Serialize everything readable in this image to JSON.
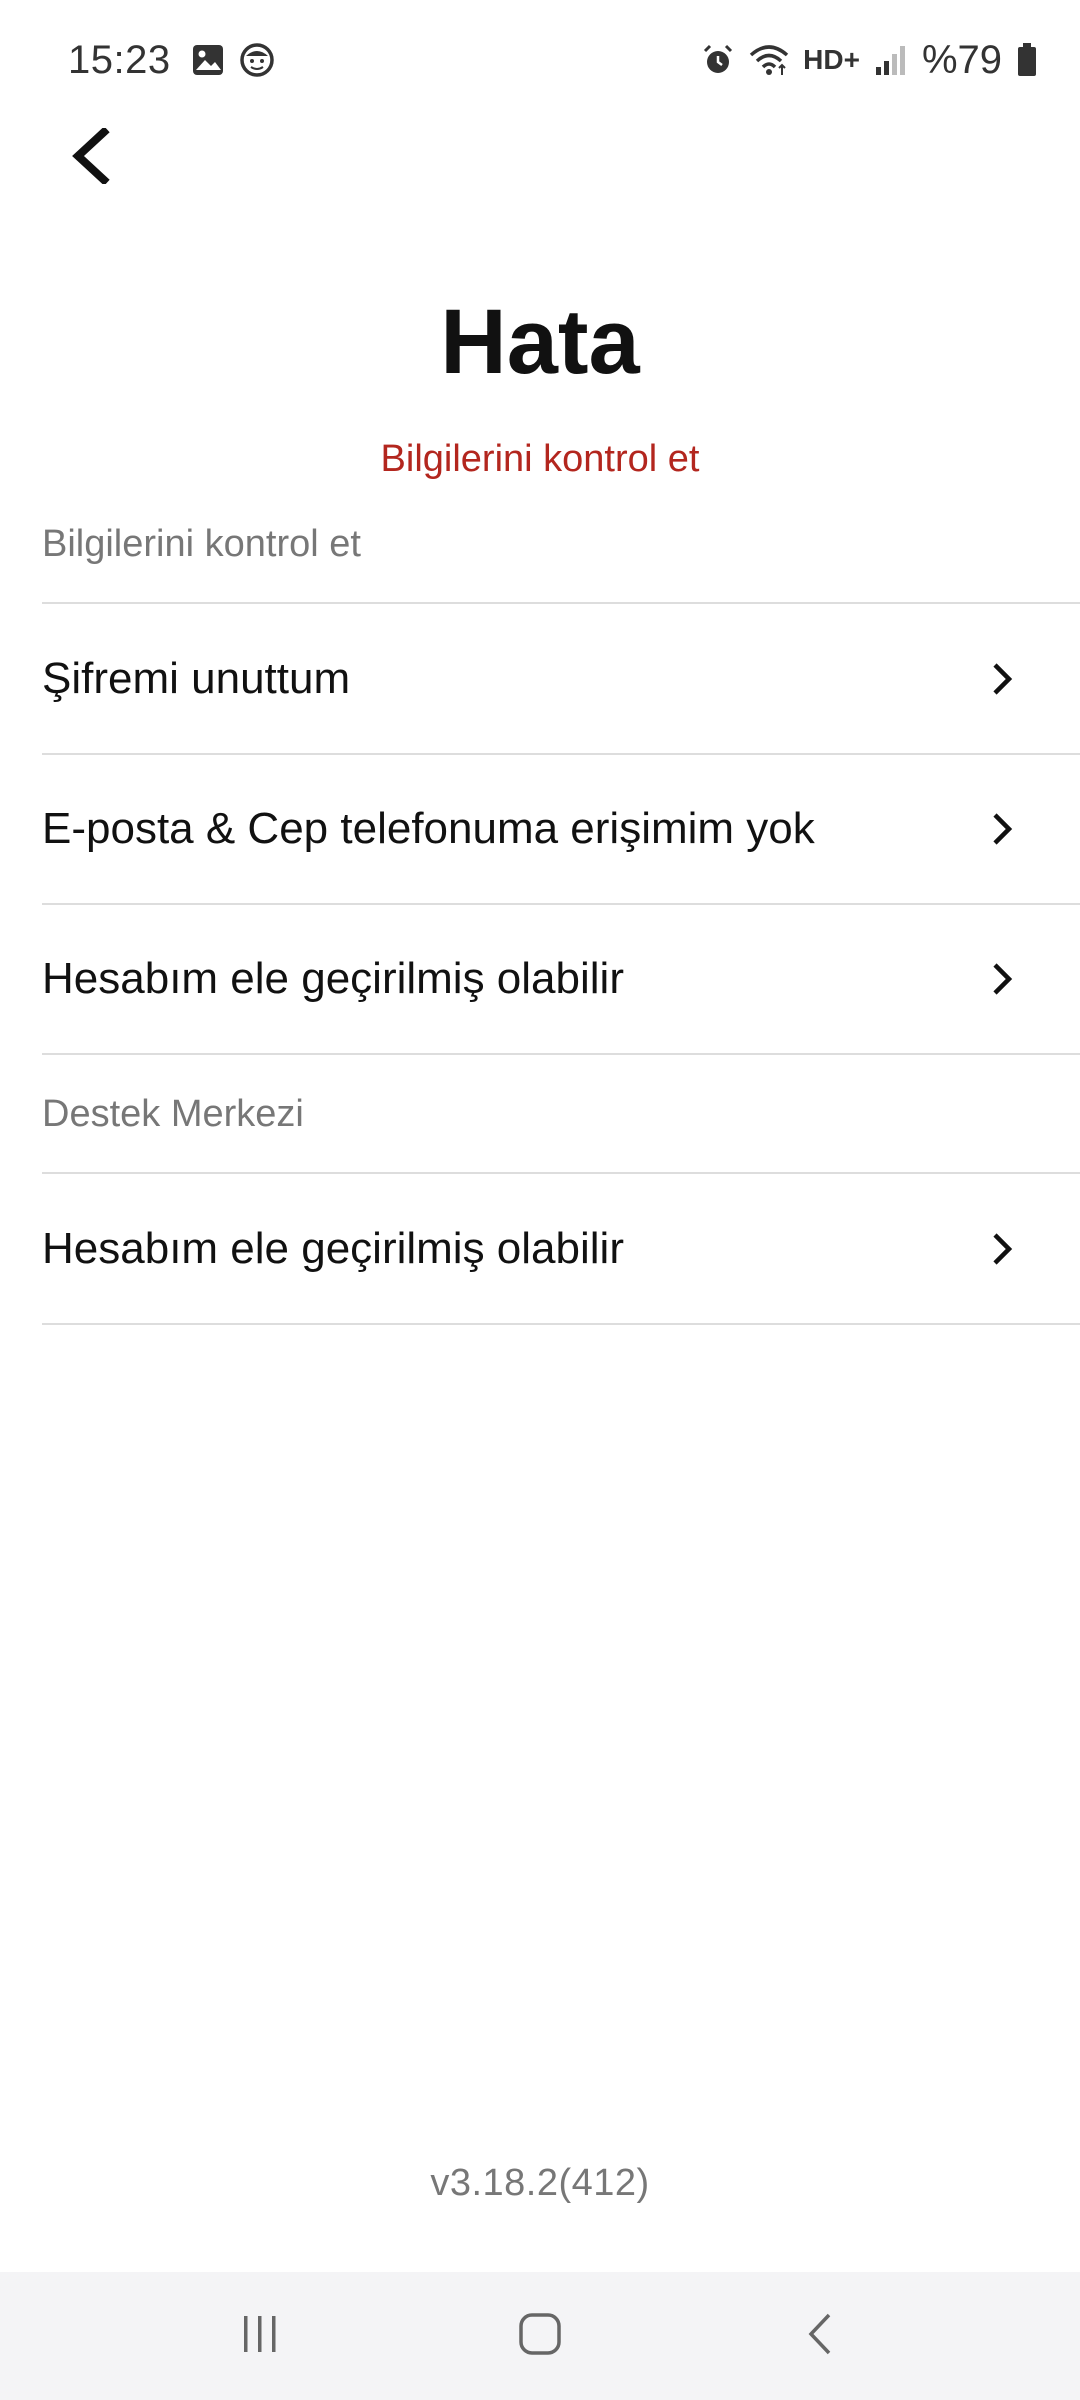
{
  "status_bar": {
    "time": "15:23",
    "battery_text": "%79",
    "network_label": "HD+",
    "icons": [
      "gallery-icon",
      "face-icon",
      "alarm-icon",
      "wifi-icon",
      "hd-plus-icon",
      "signal-icon",
      "battery-icon"
    ]
  },
  "header": {
    "back_icon": "back-chevron-icon",
    "title": "Hata",
    "subtitle": "Bilgilerini kontrol et"
  },
  "sections": [
    {
      "title": "Bilgilerini kontrol et",
      "items": [
        {
          "label": "Şifremi unuttum",
          "icon": "chevron-right-icon"
        },
        {
          "label": "E-posta & Cep telefonuma erişimim yok",
          "icon": "chevron-right-icon"
        },
        {
          "label": "Hesabım ele geçirilmiş olabilir",
          "icon": "chevron-right-icon"
        }
      ]
    },
    {
      "title": "Destek Merkezi",
      "items": [
        {
          "label": "Hesabım ele geçirilmiş olabilir",
          "icon": "chevron-right-icon"
        }
      ]
    }
  ],
  "footer": {
    "version": "v3.18.2(412)"
  },
  "nav_bar": {
    "buttons": [
      "recent-apps-icon",
      "home-icon",
      "back-icon"
    ]
  },
  "colors": {
    "error_text": "#b3261e",
    "divider": "#dddddd",
    "muted_text": "#777777",
    "nav_background": "#f4f4f6"
  }
}
